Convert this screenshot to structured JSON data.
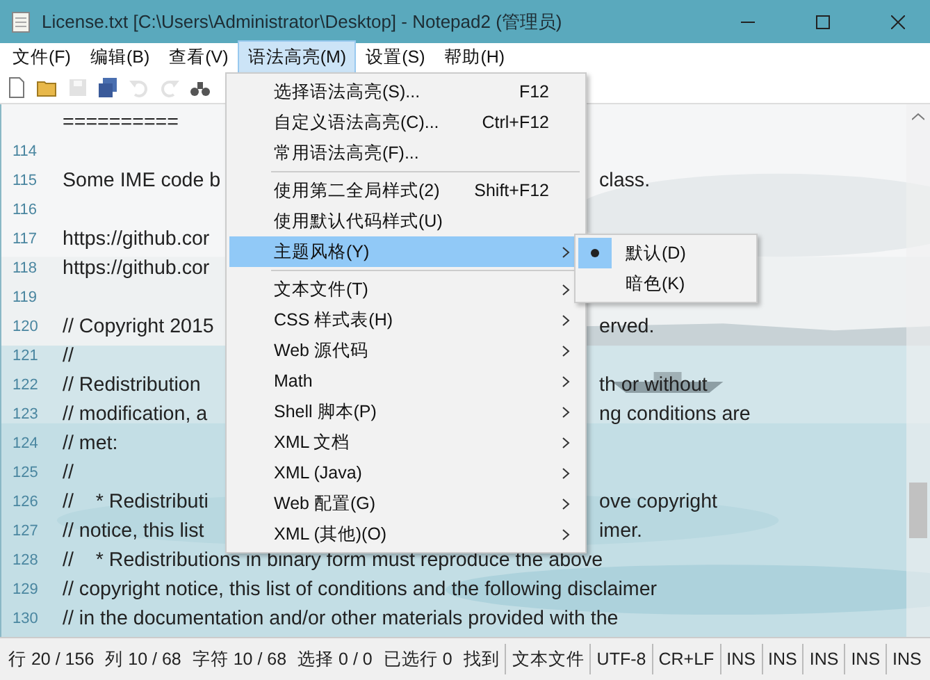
{
  "window": {
    "title": "License.txt [C:\\Users\\Administrator\\Desktop] - Notepad2 (管理员)"
  },
  "menubar": [
    {
      "label": "文件(F)",
      "selected": false
    },
    {
      "label": "编辑(B)",
      "selected": false
    },
    {
      "label": "查看(V)",
      "selected": false
    },
    {
      "label": "语法高亮(M)",
      "selected": true
    },
    {
      "label": "设置(S)",
      "selected": false
    },
    {
      "label": "帮助(H)",
      "selected": false
    }
  ],
  "toolbar": [
    {
      "kind": "new",
      "disabled": false
    },
    {
      "kind": "open",
      "disabled": false
    },
    {
      "kind": "save",
      "disabled": true
    },
    {
      "kind": "saveall",
      "disabled": false
    },
    {
      "kind": "undo",
      "disabled": true
    },
    {
      "kind": "redo",
      "disabled": true
    },
    {
      "kind": "find",
      "disabled": false
    }
  ],
  "editor": {
    "lines": [
      {
        "text": "=========="
      },
      {
        "number": "114"
      },
      {
        "number": "115",
        "text": "Some IME code b",
        "text_right": "class."
      },
      {
        "number": "116"
      },
      {
        "number": "117",
        "text": "https://github.cor"
      },
      {
        "number": "118",
        "text": "https://github.cor"
      },
      {
        "number": "119"
      },
      {
        "number": "120",
        "text": "// Copyright 2015",
        "text_right": "erved."
      },
      {
        "number": "121",
        "text": "//"
      },
      {
        "number": "122",
        "text": "// Redistribution",
        "text_right": "th or without"
      },
      {
        "number": "123",
        "text": "// modification, a",
        "text_right": "ng conditions are"
      },
      {
        "number": "124",
        "text": "// met:"
      },
      {
        "number": "125",
        "text": "//"
      },
      {
        "number": "126",
        "text": "//    * Redistributi",
        "text_right": "ove copyright"
      },
      {
        "number": "127",
        "text": "// notice, this list",
        "text_right": "imer."
      },
      {
        "number": "128",
        "text": "//    * Redistributions in binary form must reproduce the above"
      },
      {
        "number": "129",
        "text": "// copyright notice, this list of conditions and the following disclaimer"
      },
      {
        "number": "130",
        "text": "// in the documentation and/or other materials provided with the"
      }
    ]
  },
  "menu": {
    "items": [
      {
        "kind": "item",
        "label": "选择语法高亮(S)...",
        "shortcut": "F12",
        "submenu": false,
        "selected": false
      },
      {
        "kind": "item",
        "label": "自定义语法高亮(C)...",
        "shortcut": "Ctrl+F12",
        "submenu": false,
        "selected": false
      },
      {
        "kind": "item",
        "label": "常用语法高亮(F)...",
        "submenu": false,
        "selected": false
      },
      {
        "kind": "separator"
      },
      {
        "kind": "item",
        "label": "使用第二全局样式(2)",
        "shortcut": "Shift+F12",
        "submenu": false,
        "selected": false
      },
      {
        "kind": "item",
        "label": "使用默认代码样式(U)",
        "submenu": false,
        "selected": false
      },
      {
        "kind": "item",
        "label": "主题风格(Y)",
        "submenu": true,
        "selected": true
      },
      {
        "kind": "separator"
      },
      {
        "kind": "item",
        "label": "文本文件(T)",
        "submenu": true,
        "selected": false
      },
      {
        "kind": "item",
        "label": "CSS 样式表(H)",
        "submenu": true,
        "selected": false
      },
      {
        "kind": "item",
        "label": "Web 源代码",
        "submenu": true,
        "selected": false
      },
      {
        "kind": "item",
        "label": "Math",
        "submenu": true,
        "selected": false
      },
      {
        "kind": "item",
        "label": "Shell 脚本(P)",
        "submenu": true,
        "selected": false
      },
      {
        "kind": "item",
        "label": "XML 文档",
        "submenu": true,
        "selected": false
      },
      {
        "kind": "item",
        "label": "XML (Java)",
        "submenu": true,
        "selected": false
      },
      {
        "kind": "item",
        "label": "Web 配置(G)",
        "submenu": true,
        "selected": false
      },
      {
        "kind": "item",
        "label": "XML (其他)(O)",
        "submenu": true,
        "selected": false
      }
    ]
  },
  "submenu": {
    "items": [
      {
        "label": "默认(D)",
        "checked": true
      },
      {
        "label": "暗色(K)",
        "checked": false
      }
    ]
  },
  "status_bar": [
    "行 20 / 156",
    "列 10 / 68",
    "字符 10 / 68",
    "选择 0 / 0",
    "已选行 0",
    "找到",
    "文本文件",
    "UTF-8",
    "CR+LF",
    "INS",
    "INS",
    "INS",
    "INS",
    "INS"
  ]
}
